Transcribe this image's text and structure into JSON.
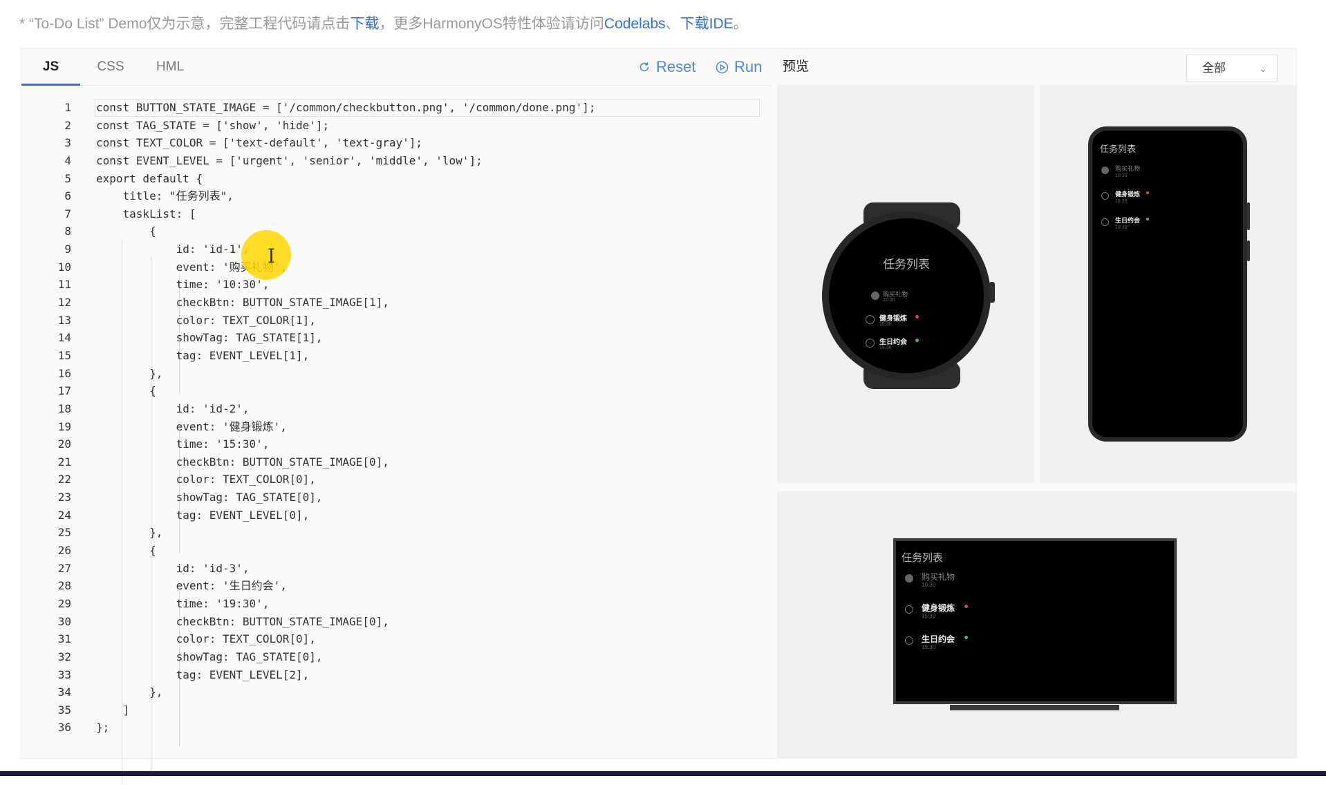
{
  "notice": {
    "prefix": "* “To-Do List” Demo仅为示意，完整工程代码请点击",
    "download_link": "下载",
    "middle": "，更多HarmonyOS特性体验请访问",
    "codelabs_link": "Codelabs",
    "separator": "、",
    "ide_link": "下载IDE",
    "suffix": "。"
  },
  "editor": {
    "tabs": [
      {
        "label": "JS",
        "active": true
      },
      {
        "label": "CSS",
        "active": false
      },
      {
        "label": "HML",
        "active": false
      }
    ],
    "reset_label": "Reset",
    "run_label": "Run",
    "accent_color": "#2f6fe0",
    "tool_color": "#4a86e8"
  },
  "code": {
    "lines": [
      "const BUTTON_STATE_IMAGE = ['/common/checkbutton.png', '/common/done.png'];",
      "const TAG_STATE = ['show', 'hide'];",
      "const TEXT_COLOR = ['text-default', 'text-gray'];",
      "const EVENT_LEVEL = ['urgent', 'senior', 'middle', 'low'];",
      "export default {",
      "    title: \"任务列表\",",
      "    taskList: [",
      "        {",
      "            id: 'id-1',",
      "            event: '购买礼物',",
      "            time: '10:30',",
      "            checkBtn: BUTTON_STATE_IMAGE[1],",
      "            color: TEXT_COLOR[1],",
      "            showTag: TAG_STATE[1],",
      "            tag: EVENT_LEVEL[1],",
      "        },",
      "        {",
      "            id: 'id-2',",
      "            event: '健身锻炼',",
      "            time: '15:30',",
      "            checkBtn: BUTTON_STATE_IMAGE[0],",
      "            color: TEXT_COLOR[0],",
      "            showTag: TAG_STATE[0],",
      "            tag: EVENT_LEVEL[0],",
      "        },",
      "        {",
      "            id: 'id-3',",
      "            event: '生日约会',",
      "            time: '19:30',",
      "            checkBtn: BUTTON_STATE_IMAGE[0],",
      "            color: TEXT_COLOR[0],",
      "            showTag: TAG_STATE[0],",
      "            tag: EVENT_LEVEL[2],",
      "        },",
      "    ]",
      "};"
    ]
  },
  "preview": {
    "label": "预览",
    "device_select": "全部",
    "app_title": "任务列表",
    "tasks": [
      {
        "event": "购买礼物",
        "time": "10:30",
        "done": true,
        "tag_color": ""
      },
      {
        "event": "健身锻炼",
        "time": "15:30",
        "done": false,
        "tag_color": "#e64545"
      },
      {
        "event": "生日约会",
        "time": "19:30",
        "done": false,
        "tag_color": "#3fb86a"
      }
    ]
  }
}
